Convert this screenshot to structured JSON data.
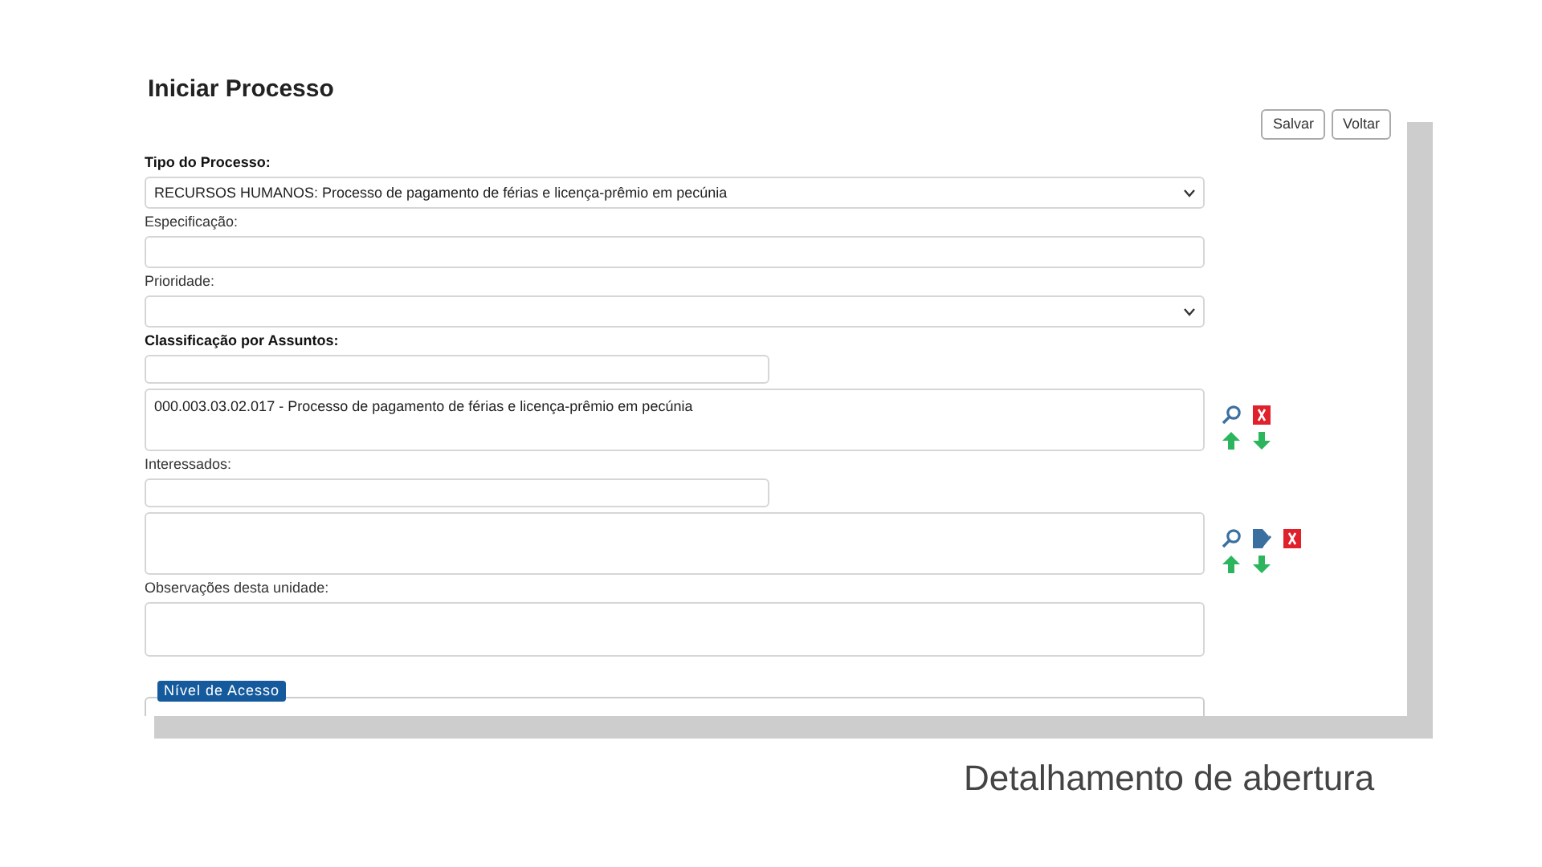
{
  "title": "Iniciar Processo",
  "buttons": [
    {
      "label": "Salvar"
    },
    {
      "label": "Voltar"
    }
  ],
  "fields": [
    {
      "kind": "select",
      "label": "Tipo do Processo:",
      "required": true,
      "value": "RECURSOS HUMANOS: Processo de pagamento de férias e licença-prêmio em pecúnia"
    },
    {
      "kind": "text",
      "label": "Especificação:",
      "required": false
    },
    {
      "kind": "select",
      "label": "Prioridade:",
      "required": false
    },
    {
      "kind": "picker",
      "label": "Classificação por Assuntos:",
      "required": true,
      "items": [
        "000.003.03.02.017 - Processo de pagamento de férias e licença-prêmio em pecúnia"
      ],
      "tools": [
        {
          "kind": "search"
        },
        {
          "kind": "remove"
        }
      ]
    },
    {
      "kind": "picker",
      "label": "Interessados:",
      "required": false,
      "tools": [
        {
          "kind": "search"
        },
        {
          "kind": "edit"
        },
        {
          "kind": "remove"
        }
      ]
    },
    {
      "kind": "textarea",
      "label": "Observações desta unidade:",
      "required": false
    },
    {
      "kind": "fieldset",
      "label": "Nível de Acesso"
    }
  ],
  "caption": "Detalhamento de abertura"
}
